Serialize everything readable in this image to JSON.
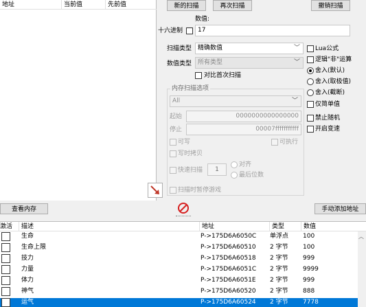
{
  "top_list": {
    "columns": [
      "地址",
      "当前值",
      "先前值"
    ]
  },
  "scan_buttons": {
    "first_scan": "新的扫描",
    "next_scan": "再次扫描",
    "undo_scan": "撤销扫描"
  },
  "value_section": {
    "label": "数值:",
    "hex_label": "十六进制",
    "value": "17"
  },
  "scan_type": {
    "label": "扫描类型",
    "selected": "精确数值"
  },
  "value_type": {
    "label": "数值类型",
    "selected": "所有类型"
  },
  "compare_first": "对比首次扫描",
  "memory_options": {
    "title": "内存扫描选项",
    "region": "All",
    "start_label": "起始",
    "start_value": "0000000000000000",
    "stop_label": "停止",
    "stop_value": "00007fffffffffff",
    "writable": "可写",
    "executable": "可执行",
    "copy_on_write": "写时拷贝",
    "fast_scan": "快速扫描",
    "fast_scan_value": "1",
    "align": "对齐",
    "last_digits": "最后位数",
    "pause_game": "扫描时暂停游戏"
  },
  "right_options": {
    "lua": "Lua公式",
    "not_logic": "逻辑\"非\"运算",
    "round_default": "舍入(默认)",
    "round_extreme": "舍入(取极值)",
    "round_truncate": "舍入(截断)",
    "simple_values": "仅简单值",
    "no_random": "禁止随机",
    "speedhack": "开启变速"
  },
  "bottom_bar": {
    "view_memory": "查看内存",
    "manual_add": "手动添加地址"
  },
  "address_table": {
    "columns": [
      "激活",
      "描述",
      "地址",
      "类型",
      "数值"
    ],
    "rows": [
      {
        "desc": "生命",
        "address": "P->175D6A6050C",
        "type": "单浮点",
        "value": "100"
      },
      {
        "desc": "生命上限",
        "address": "P->175D6A60510",
        "type": "2 字节",
        "value": "100"
      },
      {
        "desc": "技力",
        "address": "P->175D6A60518",
        "type": "2 字节",
        "value": "999"
      },
      {
        "desc": "力量",
        "address": "P->175D6A6051C",
        "type": "2 字节",
        "value": "9999"
      },
      {
        "desc": "体力",
        "address": "P->175D6A6051E",
        "type": "2 字节",
        "value": "999"
      },
      {
        "desc": "神气",
        "address": "P->175D6A60520",
        "type": "2 字节",
        "value": "888"
      },
      {
        "desc": "运气",
        "address": "P->175D6A60524",
        "type": "2 字节",
        "value": "7778"
      }
    ]
  },
  "colors": {
    "selection": "#0078d7",
    "arrow": "#c0392b",
    "stop_icon": "#d62020"
  }
}
